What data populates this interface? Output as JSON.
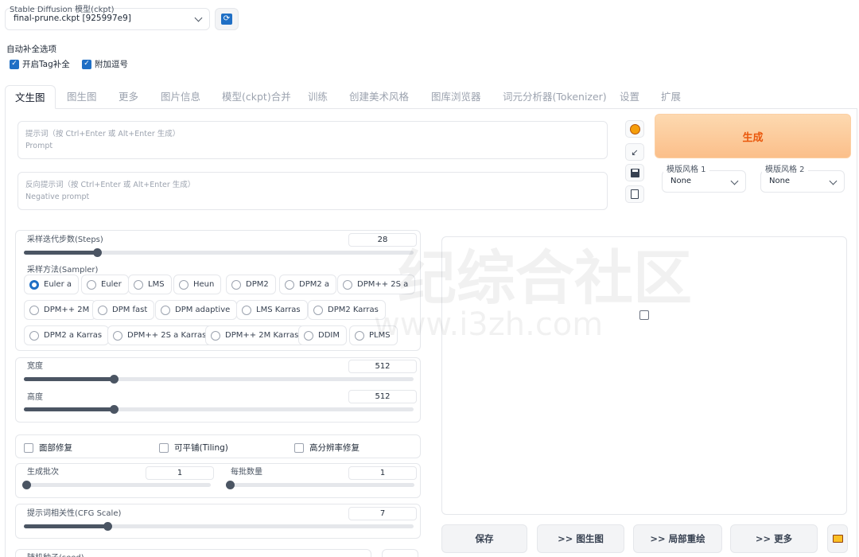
{
  "model": {
    "label": "Stable Diffusion 模型(ckpt)",
    "value": "final-prune.ckpt [925997e9]"
  },
  "autocomplete": {
    "title": "自动补全选项",
    "options": [
      {
        "label": "开启Tag补全",
        "checked": true
      },
      {
        "label": "附加逗号",
        "checked": true
      }
    ]
  },
  "tabs": [
    "文生图",
    "图生图",
    "更多",
    "图片信息",
    "模型(ckpt)合并",
    "训练",
    "创建美术风格",
    "图库浏览器",
    "词元分析器(Tokenizer)",
    "设置",
    "扩展"
  ],
  "prompt": {
    "placeholder_line1": "提示词（按 Ctrl+Enter 或 Alt+Enter 生成）",
    "placeholder_line2": "Prompt"
  },
  "negative_prompt": {
    "placeholder_line1": "反向提示词（按 Ctrl+Enter 或 Alt+Enter 生成）",
    "placeholder_line2": "Negative prompt"
  },
  "generate": {
    "label": "生成"
  },
  "styles": [
    {
      "label": "模版风格 1",
      "value": "None"
    },
    {
      "label": "模版风格 2",
      "value": "None"
    }
  ],
  "steps": {
    "label": "采样迭代步数(Steps)",
    "value": "28"
  },
  "sampler": {
    "label": "采样方法(Sampler)",
    "options": [
      "Euler a",
      "Euler",
      "LMS",
      "Heun",
      "DPM2",
      "DPM2 a",
      "DPM++ 2S a",
      "DPM++ 2M",
      "DPM fast",
      "DPM adaptive",
      "LMS Karras",
      "DPM2 Karras",
      "DPM2 a Karras",
      "DPM++ 2S a Karras",
      "DPM++ 2M Karras",
      "DDIM",
      "PLMS"
    ],
    "selected": "Euler a"
  },
  "width": {
    "label": "宽度",
    "value": "512"
  },
  "height": {
    "label": "高度",
    "value": "512"
  },
  "checks": [
    {
      "label": "面部修复",
      "checked": false
    },
    {
      "label": "可平铺(Tiling)",
      "checked": false
    },
    {
      "label": "高分辨率修复",
      "checked": false
    }
  ],
  "batch_count": {
    "label": "生成批次",
    "value": "1"
  },
  "batch_size": {
    "label": "每批数量",
    "value": "1"
  },
  "cfg": {
    "label": "提示词相关性(CFG Scale)",
    "value": "7"
  },
  "seed": {
    "label": "随机种子(seed)"
  },
  "actions": {
    "save": "保存",
    "img2img": ">> 图生图",
    "inpaint": ">> 局部重绘",
    "extras": ">> 更多"
  },
  "watermark": {
    "text1": "纪综合社区",
    "text2": "www.i3zh.com"
  },
  "colors": {
    "accent": "#1f6fc5",
    "generate_bg": "#fbbf8a",
    "generate_text": "#ea580c"
  }
}
